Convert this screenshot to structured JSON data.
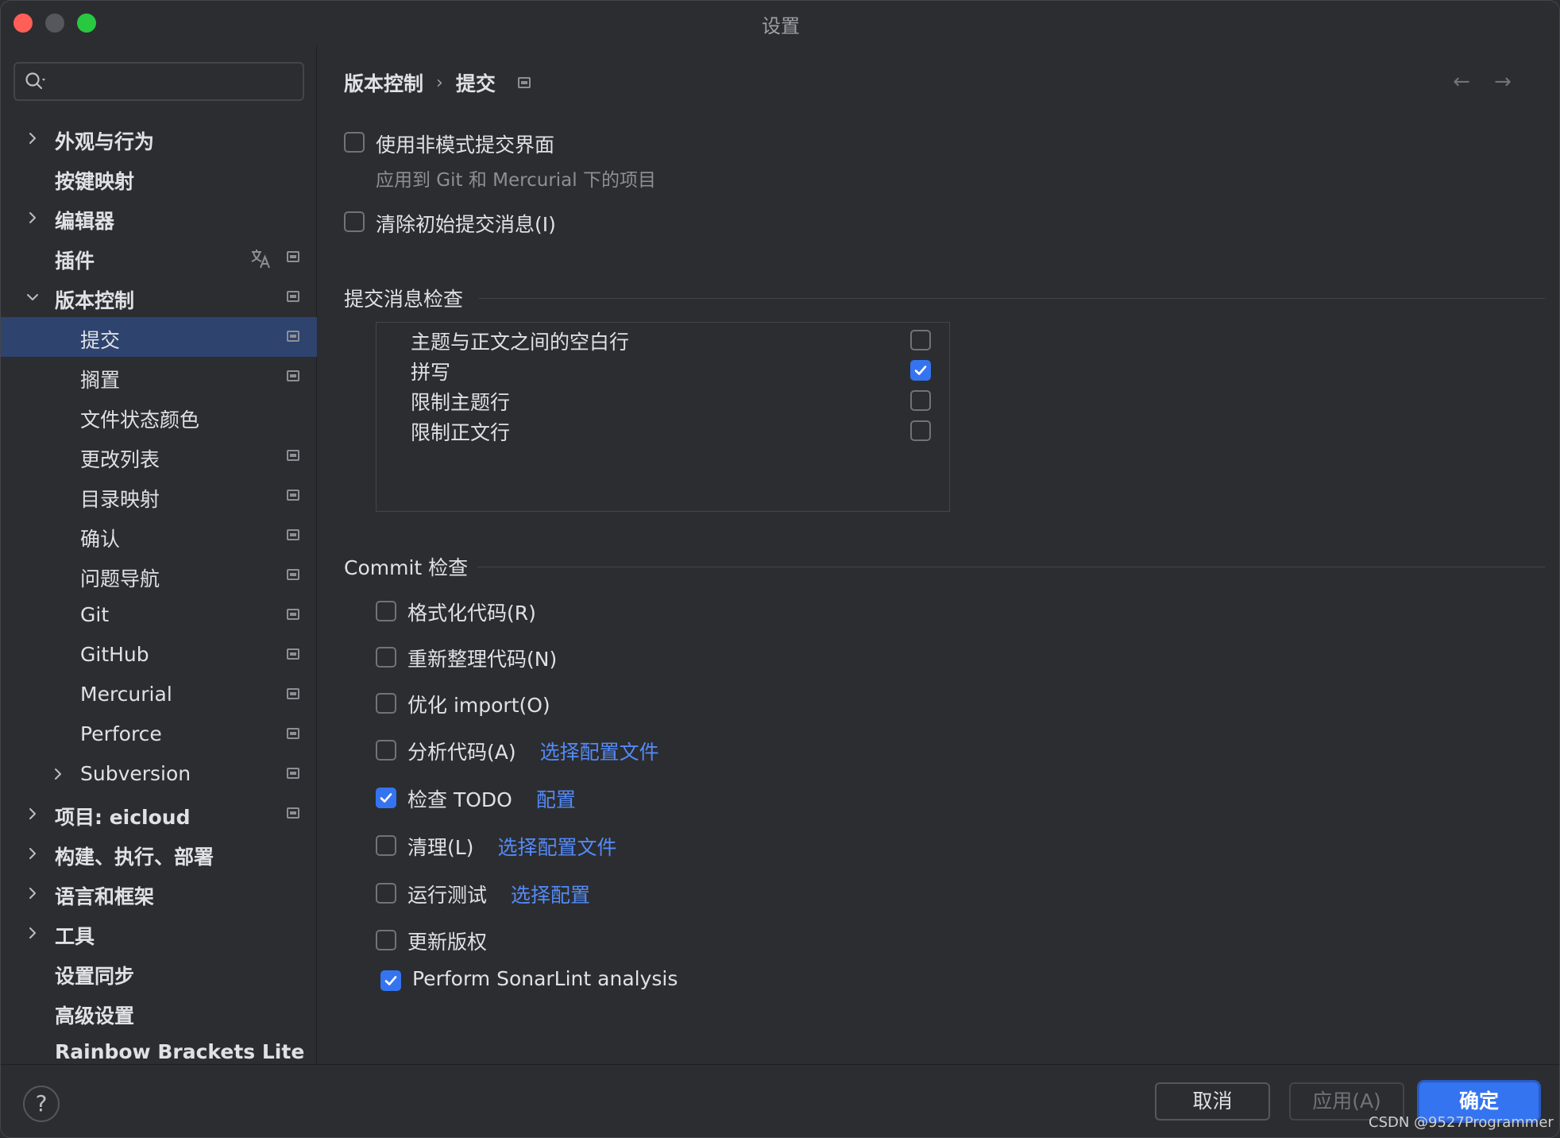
{
  "window": {
    "title": "设置"
  },
  "sidebar": {
    "search_placeholder": "",
    "items": [
      {
        "label": "外观与行为",
        "expand": "collapsed",
        "indent": 0,
        "bold": true,
        "mod": false,
        "translate": false
      },
      {
        "label": "按键映射",
        "expand": "none",
        "indent": 0,
        "bold": true,
        "mod": false,
        "translate": false
      },
      {
        "label": "编辑器",
        "expand": "collapsed",
        "indent": 0,
        "bold": true,
        "mod": false,
        "translate": false
      },
      {
        "label": "插件",
        "expand": "none",
        "indent": 0,
        "bold": true,
        "mod": true,
        "translate": true
      },
      {
        "label": "版本控制",
        "expand": "expanded",
        "indent": 0,
        "bold": true,
        "mod": true,
        "translate": false
      },
      {
        "label": "提交",
        "expand": "none",
        "indent": 1,
        "bold": false,
        "mod": true,
        "translate": false,
        "selected": true
      },
      {
        "label": "搁置",
        "expand": "none",
        "indent": 1,
        "bold": false,
        "mod": true,
        "translate": false
      },
      {
        "label": "文件状态颜色",
        "expand": "none",
        "indent": 1,
        "bold": false,
        "mod": false,
        "translate": false
      },
      {
        "label": "更改列表",
        "expand": "none",
        "indent": 1,
        "bold": false,
        "mod": true,
        "translate": false
      },
      {
        "label": "目录映射",
        "expand": "none",
        "indent": 1,
        "bold": false,
        "mod": true,
        "translate": false
      },
      {
        "label": "确认",
        "expand": "none",
        "indent": 1,
        "bold": false,
        "mod": true,
        "translate": false
      },
      {
        "label": "问题导航",
        "expand": "none",
        "indent": 1,
        "bold": false,
        "mod": true,
        "translate": false
      },
      {
        "label": "Git",
        "expand": "none",
        "indent": 1,
        "bold": false,
        "mod": true,
        "translate": false
      },
      {
        "label": "GitHub",
        "expand": "none",
        "indent": 1,
        "bold": false,
        "mod": true,
        "translate": false
      },
      {
        "label": "Mercurial",
        "expand": "none",
        "indent": 1,
        "bold": false,
        "mod": true,
        "translate": false
      },
      {
        "label": "Perforce",
        "expand": "none",
        "indent": 1,
        "bold": false,
        "mod": true,
        "translate": false
      },
      {
        "label": "Subversion",
        "expand": "collapsed",
        "indent": 1,
        "bold": false,
        "mod": true,
        "translate": false
      },
      {
        "label": "项目: eicloud",
        "expand": "collapsed",
        "indent": 0,
        "bold": true,
        "mod": true,
        "translate": false
      },
      {
        "label": "构建、执行、部署",
        "expand": "collapsed",
        "indent": 0,
        "bold": true,
        "mod": false,
        "translate": false
      },
      {
        "label": "语言和框架",
        "expand": "collapsed",
        "indent": 0,
        "bold": true,
        "mod": false,
        "translate": false
      },
      {
        "label": "工具",
        "expand": "collapsed",
        "indent": 0,
        "bold": true,
        "mod": false,
        "translate": false
      },
      {
        "label": "设置同步",
        "expand": "none",
        "indent": 0,
        "bold": true,
        "mod": false,
        "translate": false
      },
      {
        "label": "高级设置",
        "expand": "none",
        "indent": 0,
        "bold": true,
        "mod": false,
        "translate": false
      },
      {
        "label": "Rainbow Brackets Lite",
        "expand": "none",
        "indent": 0,
        "bold": true,
        "mod": false,
        "translate": false
      }
    ]
  },
  "main": {
    "breadcrumb": {
      "parent": "版本控制",
      "separator": "›",
      "current": "提交"
    },
    "nav_back": "←",
    "nav_forward": "→",
    "general": {
      "non_modal": {
        "label": "使用非模式提交界面",
        "checked": false,
        "hint": "应用到 Git 和 Mercurial 下的项目"
      },
      "clear_initial": {
        "label": "清除初始提交消息(I)",
        "checked": false
      }
    },
    "message_inspections": {
      "title": "提交消息检查",
      "items": [
        {
          "label": "主题与正文之间的空白行",
          "checked": false
        },
        {
          "label": "拼写",
          "checked": true
        },
        {
          "label": "限制主题行",
          "checked": false
        },
        {
          "label": "限制正文行",
          "checked": false
        }
      ]
    },
    "commit_checks": {
      "title": "Commit 检查",
      "items": [
        {
          "label": "格式化代码(R)",
          "checked": false,
          "link": ""
        },
        {
          "label": "重新整理代码(N)",
          "checked": false,
          "link": ""
        },
        {
          "label": "优化 import(O)",
          "checked": false,
          "link": ""
        },
        {
          "label": "分析代码(A)",
          "checked": false,
          "link": "选择配置文件"
        },
        {
          "label": "检查 TODO",
          "checked": true,
          "link": "配置"
        },
        {
          "label": "清理(L)",
          "checked": false,
          "link": "选择配置文件"
        },
        {
          "label": "运行测试",
          "checked": false,
          "link": "选择配置"
        },
        {
          "label": "更新版权",
          "checked": false,
          "link": ""
        },
        {
          "label": "Perform SonarLint analysis",
          "checked": true,
          "link": ""
        }
      ]
    }
  },
  "footer": {
    "help": "?",
    "cancel": "取消",
    "apply": "应用(A)",
    "ok": "确定",
    "watermark": "CSDN @9527Programmer"
  },
  "colors": {
    "accent": "#3574f0",
    "link": "#548af7",
    "selected_row": "#2e436e",
    "background": "#2b2d30"
  }
}
